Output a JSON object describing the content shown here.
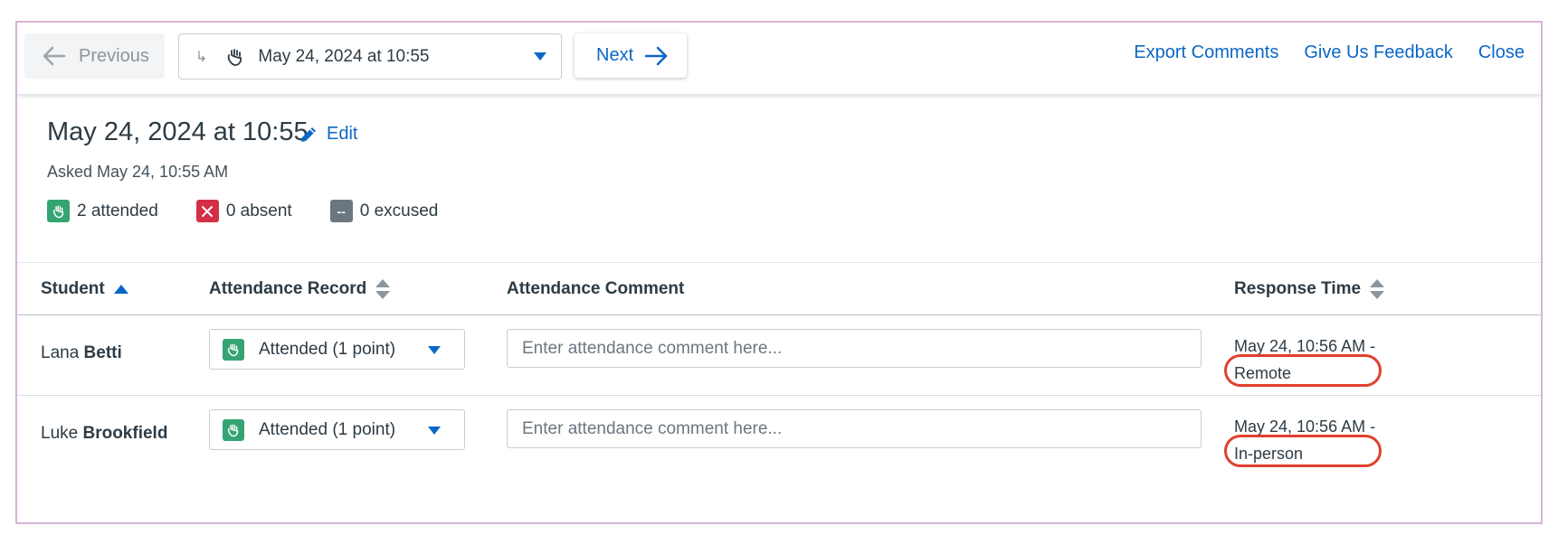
{
  "toolbar": {
    "previous_label": "Previous",
    "session_label": "May 24, 2024 at 10:55",
    "next_label": "Next",
    "links": [
      "Export Comments",
      "Give Us Feedback",
      "Close"
    ]
  },
  "header": {
    "title": "May 24, 2024 at 10:55",
    "edit_label": "Edit",
    "asked": "Asked May 24, 10:55 AM",
    "stats": {
      "attended": "2 attended",
      "absent": "0 absent",
      "excused": "0 excused",
      "excused_badge": "--"
    }
  },
  "table": {
    "columns": {
      "student": "Student",
      "record": "Attendance Record",
      "comment": "Attendance Comment",
      "response": "Response Time"
    },
    "rows": [
      {
        "first": "Lana ",
        "last": "Betti",
        "record": "Attended (1 point)",
        "comment_placeholder": "Enter attendance comment here...",
        "response_time": "May 24, 10:56 AM -",
        "mode": "Remote"
      },
      {
        "first": "Luke ",
        "last": "Brookfield",
        "record": "Attended (1 point)",
        "comment_placeholder": "Enter attendance comment here...",
        "response_time": "May 24, 10:56 AM -",
        "mode": "In-person"
      }
    ]
  },
  "colors": {
    "accent": "#0b67c6",
    "attended": "#35a472",
    "absent": "#d33045",
    "excused": "#6b7780",
    "annotation": "#e0402e",
    "frame": "#d6b4da"
  },
  "icons": [
    "arrow-left-icon",
    "subdirectory-arrow-icon",
    "raised-hand-icon",
    "chevron-down-icon",
    "arrow-right-icon",
    "pencil-icon",
    "sort-asc-icon",
    "sort-icon",
    "close-x-icon"
  ]
}
